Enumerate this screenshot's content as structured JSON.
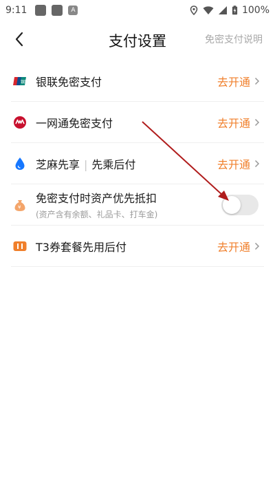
{
  "status_bar": {
    "time": "9:11",
    "battery": "100%"
  },
  "header": {
    "title": "支付设置",
    "help_link": "免密支付说明"
  },
  "rows": [
    {
      "label": "银联免密支付",
      "action": "去开通",
      "icon": "unionpay-icon"
    },
    {
      "label": "一网通免密支付",
      "action": "去开通",
      "icon": "cmb-icon"
    },
    {
      "label_main": "芝麻先享",
      "separator": "|",
      "label_sub": "先乘后付",
      "action": "去开通",
      "icon": "sesame-drop-icon"
    },
    {
      "label": "免密支付时资产优先抵扣",
      "sub": "(资产含有余额、礼品卡、打车金)",
      "icon": "money-bag-icon",
      "toggle_on": false
    },
    {
      "label": "T3券套餐先用后付",
      "action": "去开通",
      "icon": "t3-coupon-icon"
    }
  ],
  "colors": {
    "accent": "#f07f2b",
    "annotation_arrow": "#b01c1c"
  }
}
